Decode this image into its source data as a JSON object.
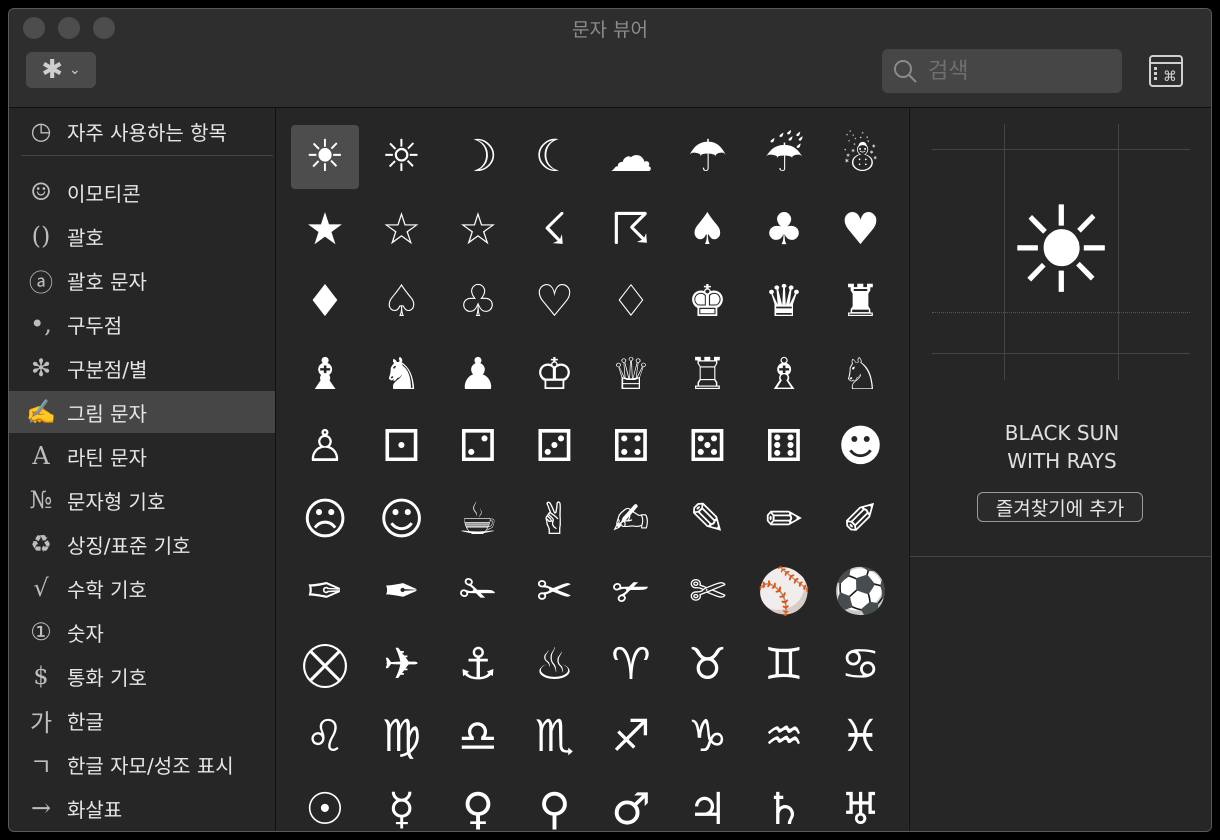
{
  "window": {
    "title": "문자 뷰어"
  },
  "toolbar": {
    "gear_icon": "✱",
    "chevron": "⌄"
  },
  "search": {
    "placeholder": "검색",
    "value": ""
  },
  "sidebar": {
    "items": [
      {
        "icon": "◷",
        "label": "자주 사용하는 항목"
      },
      {
        "icon": "☺",
        "label": "이모티콘"
      },
      {
        "icon": "()",
        "label": "괄호"
      },
      {
        "icon": "ⓐ",
        "label": "괄호 문자"
      },
      {
        "icon": "•,",
        "label": "구두점"
      },
      {
        "icon": "✻",
        "label": "구분점/별"
      },
      {
        "icon": "✍",
        "label": "그림 문자"
      },
      {
        "icon": "A",
        "label": "라틴 문자"
      },
      {
        "icon": "№",
        "label": "문자형 기호"
      },
      {
        "icon": "♻",
        "label": "상징/표준 기호"
      },
      {
        "icon": "√",
        "label": "수학 기호"
      },
      {
        "icon": "①",
        "label": "숫자"
      },
      {
        "icon": "$",
        "label": "통화 기호"
      },
      {
        "icon": "가",
        "label": "한글"
      },
      {
        "icon": "ㄱ",
        "label": "한글 자모/성조 표시"
      },
      {
        "icon": "→",
        "label": "화살표"
      }
    ],
    "selected_index": 6
  },
  "grid": {
    "chars": [
      "☀",
      "☼",
      "☽",
      "☾",
      "☁",
      "☂",
      "☔",
      "☃",
      "★",
      "☆",
      "☆",
      "☇",
      "☈",
      "♠",
      "♣",
      "♥",
      "♦",
      "♤",
      "♧",
      "♡",
      "♢",
      "♚",
      "♛",
      "♜",
      "♝",
      "♞",
      "♟",
      "♔",
      "♕",
      "♖",
      "♗",
      "♘",
      "♙",
      "⚀",
      "⚁",
      "⚂",
      "⚃",
      "⚄",
      "⚅",
      "☻",
      "☹",
      "☺",
      "☕",
      "✌",
      "✍",
      "✎",
      "✏",
      "✐",
      "✑",
      "✒",
      "✁",
      "✂",
      "✃",
      "✄",
      "⚾",
      "⚽",
      "⛒",
      "✈",
      "⚓",
      "♨",
      "♈",
      "♉",
      "♊",
      "♋",
      "♌",
      "♍",
      "♎",
      "♏",
      "♐",
      "♑",
      "♒",
      "♓",
      "☉",
      "☿",
      "♀",
      "⚲",
      "♂",
      "♃",
      "♄",
      "♅"
    ],
    "selected_index": 0
  },
  "detail": {
    "glyph": "☀",
    "name_line1": "BLACK SUN",
    "name_line2": "WITH RAYS",
    "favorite_button": "즐겨찾기에 추가"
  }
}
